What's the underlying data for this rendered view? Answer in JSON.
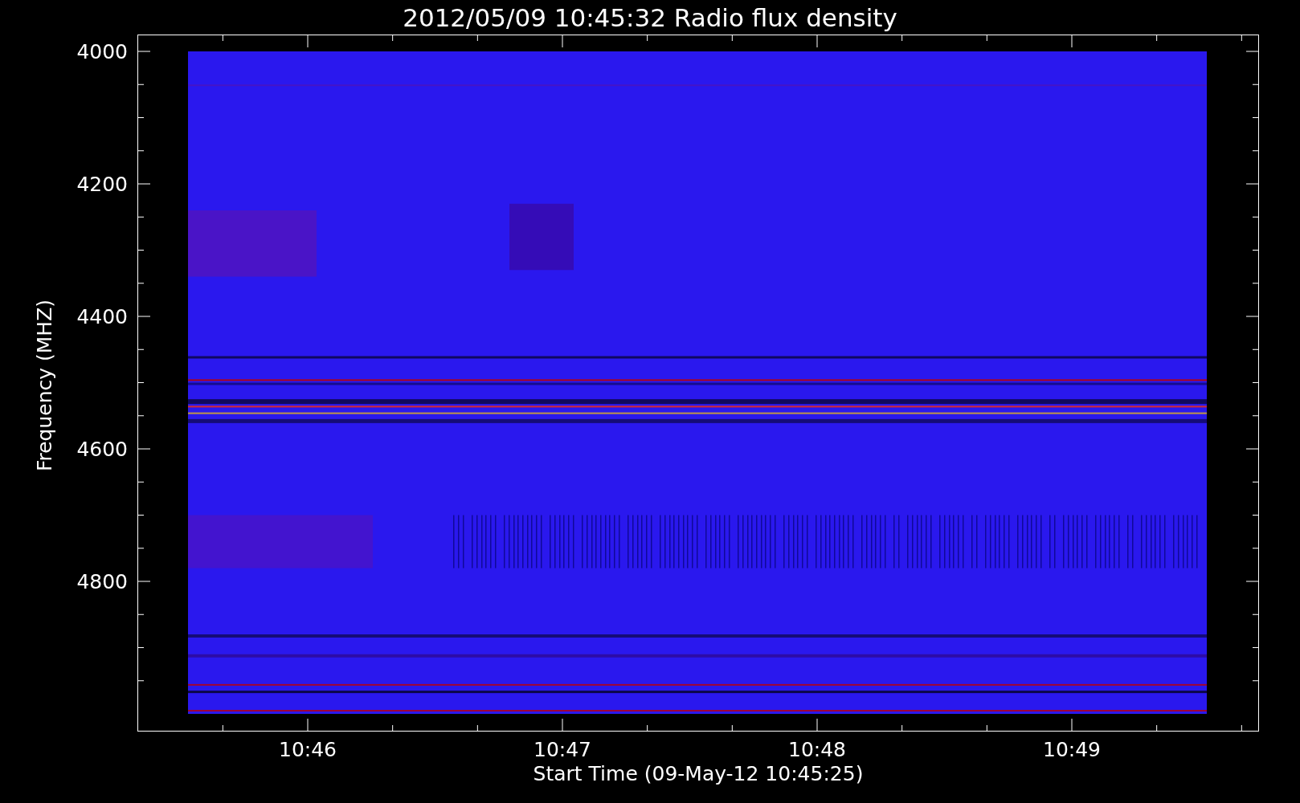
{
  "title": "2012/05/09 10:45:32 Radio flux density",
  "y_axis": {
    "label": "Frequency (MHZ)",
    "ticks": [
      "4000",
      "4200",
      "4400",
      "4600",
      "4800"
    ]
  },
  "x_axis": {
    "label": "Start Time (09-May-12 10:45:25)",
    "ticks": [
      "10:46",
      "10:47",
      "10:48",
      "10:49"
    ]
  }
}
